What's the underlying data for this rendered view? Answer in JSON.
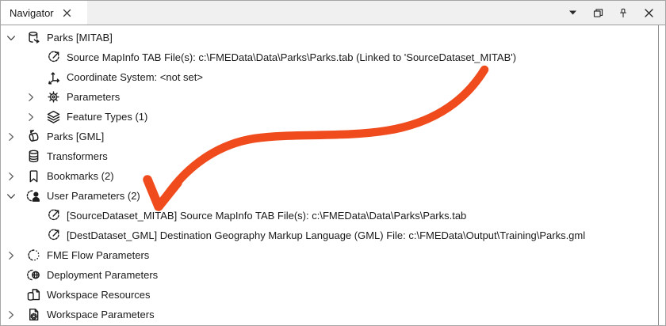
{
  "panel": {
    "tab_title": "Navigator",
    "tab_close_icon": "close-icon",
    "titlebar_buttons": [
      {
        "name": "dock-menu-button",
        "icon": "chevron-dropdown-icon"
      },
      {
        "name": "float-button",
        "icon": "float-window-icon"
      },
      {
        "name": "pin-button",
        "icon": "pin-icon"
      },
      {
        "name": "close-button",
        "icon": "close-icon"
      }
    ]
  },
  "tree": {
    "items": [
      {
        "label": "Parks [MITAB]",
        "level": 0,
        "expanded": true,
        "icon": "reader-dataset-icon"
      },
      {
        "label": "Source MapInfo TAB File(s): c:\\FMEData\\Data\\Parks\\Parks.tab (Linked to 'SourceDataset_MITAB')",
        "level": 1,
        "expanded": null,
        "icon": "linked-parameter-icon"
      },
      {
        "label": "Coordinate System: <not set>",
        "level": 1,
        "expanded": null,
        "icon": "coordinate-system-icon"
      },
      {
        "label": "Parameters",
        "level": 1,
        "expanded": false,
        "icon": "gear-icon"
      },
      {
        "label": "Feature Types (1)",
        "level": 1,
        "expanded": false,
        "icon": "layers-icon"
      },
      {
        "label": "Parks [GML]",
        "level": 0,
        "expanded": false,
        "icon": "writer-dataset-icon"
      },
      {
        "label": "Transformers",
        "level": 0,
        "expanded": null,
        "icon": "database-stack-icon"
      },
      {
        "label": "Bookmarks (2)",
        "level": 0,
        "expanded": false,
        "icon": "bookmark-icon"
      },
      {
        "label": "User Parameters (2)",
        "level": 0,
        "expanded": true,
        "icon": "user-gear-icon"
      },
      {
        "label": "[SourceDataset_MITAB] Source MapInfo TAB File(s): c:\\FMEData\\Data\\Parks\\Parks.tab",
        "level": 1,
        "expanded": null,
        "icon": "linked-parameter-icon"
      },
      {
        "label": "[DestDataset_GML] Destination Geography Markup Language (GML) File: c:\\FMEData\\Output\\Training\\Parks.gml",
        "level": 1,
        "expanded": null,
        "icon": "linked-parameter-icon"
      },
      {
        "label": "FME Flow Parameters",
        "level": 0,
        "expanded": false,
        "icon": "dashed-gear-icon"
      },
      {
        "label": "Deployment Parameters",
        "level": 0,
        "expanded": null,
        "icon": "gear-globe-icon"
      },
      {
        "label": "Workspace Resources",
        "level": 0,
        "expanded": null,
        "icon": "database-page-icon"
      },
      {
        "label": "Workspace Parameters",
        "level": 0,
        "expanded": false,
        "icon": "page-gear-icon"
      }
    ]
  },
  "annotation": {
    "type": "hand-drawn-arrow",
    "color": "#F04B1D",
    "points_to": "User Parameters children"
  }
}
